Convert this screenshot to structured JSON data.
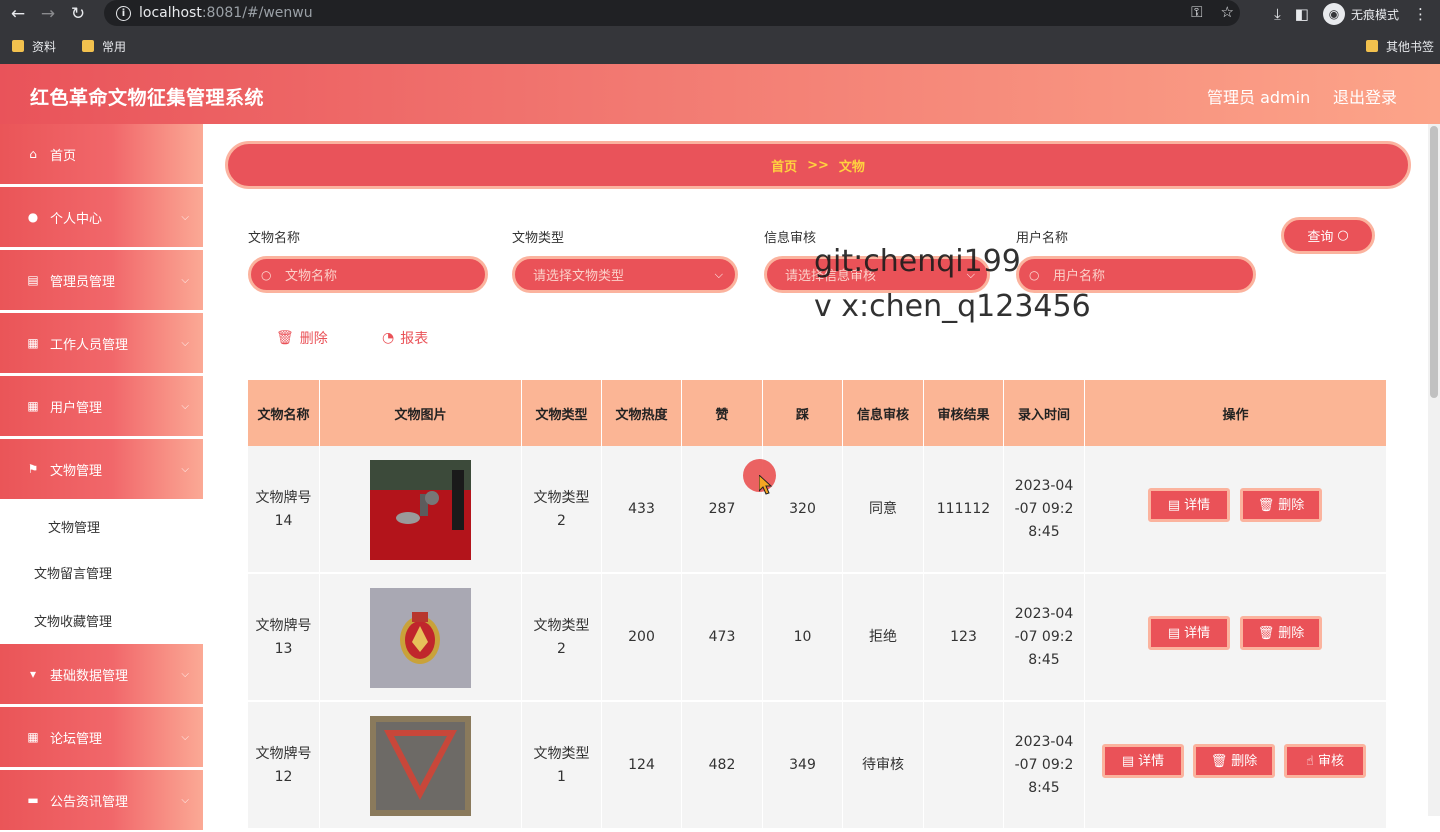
{
  "browser": {
    "url_host": "localhost",
    "url_rest": ":8081/#/wenwu",
    "incognito_label": "无痕模式",
    "bookmarks": [
      "资料",
      "常用"
    ],
    "other_bookmarks": "其他书签"
  },
  "header": {
    "title": "红色革命文物征集管理系统",
    "user": "管理员 admin",
    "logout": "退出登录"
  },
  "sidebar": {
    "items": [
      {
        "label": "首页",
        "icon": "home-icon"
      },
      {
        "label": "个人中心",
        "icon": "user-icon"
      },
      {
        "label": "管理员管理",
        "icon": "briefcase-icon"
      },
      {
        "label": "工作人员管理",
        "icon": "grid-icon"
      },
      {
        "label": "用户管理",
        "icon": "grid-icon"
      },
      {
        "label": "文物管理",
        "icon": "flag-icon"
      },
      {
        "label": "基础数据管理",
        "icon": "cup-icon"
      },
      {
        "label": "论坛管理",
        "icon": "grid-icon"
      },
      {
        "label": "公告资讯管理",
        "icon": "cup-icon"
      }
    ],
    "submenu": [
      "文物管理",
      "文物留言管理",
      "文物收藏管理"
    ]
  },
  "breadcrumb": {
    "home": "首页",
    "sep": ">>",
    "current": "文物"
  },
  "filters": {
    "name_label": "文物名称",
    "name_placeholder": "文物名称",
    "type_label": "文物类型",
    "type_placeholder": "请选择文物类型",
    "audit_label": "信息审核",
    "audit_placeholder": "请选择信息审核",
    "user_label": "用户名称",
    "user_placeholder": "用户名称",
    "query_button": "查询"
  },
  "actions": {
    "delete": "删除",
    "report": "报表"
  },
  "watermark": [
    "git:chenqi199",
    "v x:chen_q123456"
  ],
  "table": {
    "headers": [
      "文物名称",
      "文物图片",
      "文物类型",
      "文物热度",
      "赞",
      "踩",
      "信息审核",
      "审核结果",
      "录入时间",
      "操作"
    ],
    "rows": [
      {
        "name": "文物牌号14",
        "type": "文物类型2",
        "heat": "433",
        "likes": "287",
        "dislikes": "320",
        "audit": "同意",
        "result": "111112",
        "time": "2023-04-07 09:28:45",
        "buttons": [
          "详情",
          "删除"
        ]
      },
      {
        "name": "文物牌号13",
        "type": "文物类型2",
        "heat": "200",
        "likes": "473",
        "dislikes": "10",
        "audit": "拒绝",
        "result": "123",
        "time": "2023-04-07 09:28:45",
        "buttons": [
          "详情",
          "删除"
        ]
      },
      {
        "name": "文物牌号12",
        "type": "文物类型1",
        "heat": "124",
        "likes": "482",
        "dislikes": "349",
        "audit": "待审核",
        "result": "",
        "time": "2023-04-07 09:28:45",
        "buttons": [
          "详情",
          "删除",
          "审核"
        ]
      }
    ]
  },
  "colors": {
    "primary": "#ea5258",
    "accent_border": "#fbb39e",
    "table_header": "#fbb595",
    "breadcrumb_text": "#ffd23f"
  }
}
